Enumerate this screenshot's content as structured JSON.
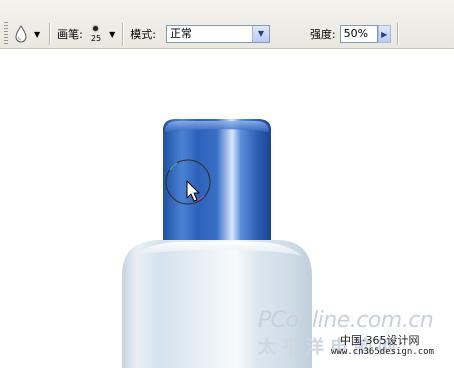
{
  "toolbar": {
    "brush_label": "画笔:",
    "brush_size": "25",
    "mode_label": "模式:",
    "mode_value": "正常",
    "strength_label": "强度:",
    "strength_value": "50%"
  },
  "icons": {
    "tool": "water-drop-icon",
    "tool_arrow": "chevron-down-icon",
    "brush_arrow": "chevron-down-icon",
    "mode_dropdown": "chevron-down-icon",
    "strength_slider": "chevron-right-icon",
    "cursor": "pointer-cursor-icon"
  },
  "canvas": {
    "bottle_cap_color": "#2f62b8",
    "bottle_body_color": "#dde7ef"
  },
  "watermark": {
    "brand": "PConline.com.cn",
    "brand_cn": "太平洋电脑网",
    "site_cn": "中国·365设计网",
    "site_url": "www.cn365design.com"
  }
}
